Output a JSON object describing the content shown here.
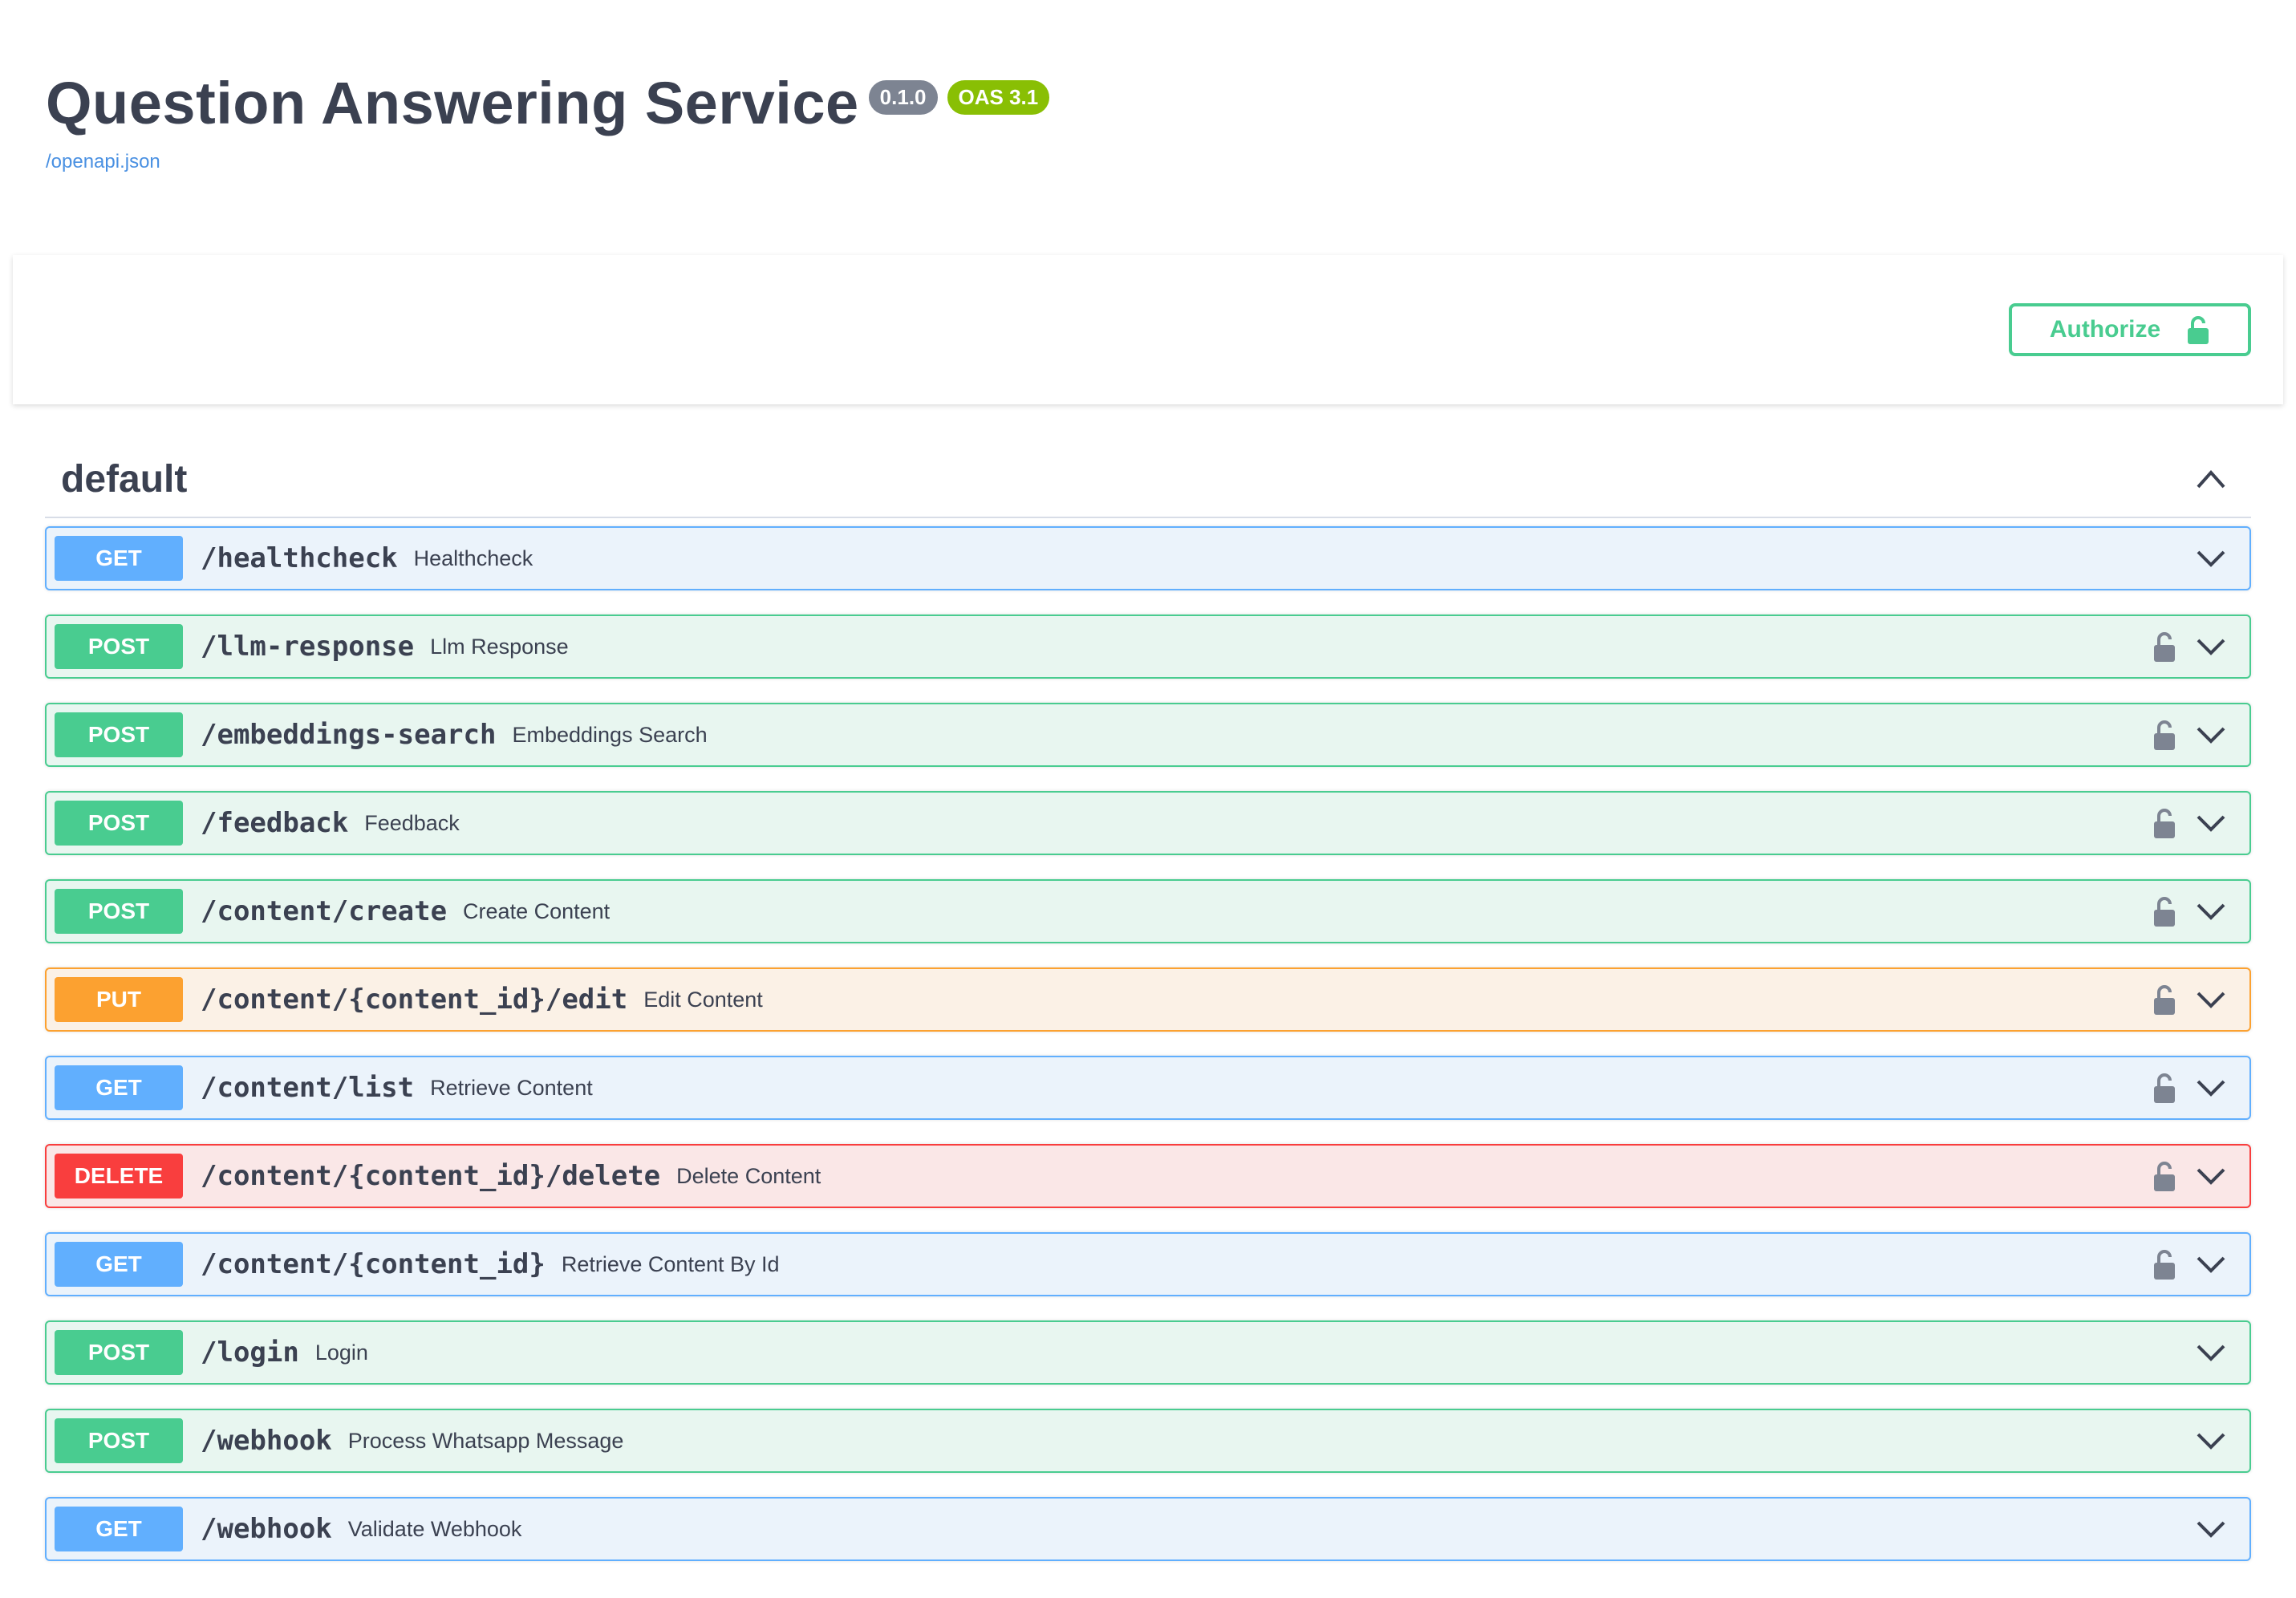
{
  "info": {
    "title": "Question Answering Service",
    "version": "0.1.0",
    "oas": "OAS 3.1",
    "spec_link": "/openapi.json"
  },
  "authorize": {
    "label": "Authorize"
  },
  "tag": {
    "name": "default"
  },
  "operations": [
    {
      "method": "GET",
      "path": "/healthcheck",
      "summary": "Healthcheck",
      "locked": false
    },
    {
      "method": "POST",
      "path": "/llm-response",
      "summary": "Llm Response",
      "locked": true
    },
    {
      "method": "POST",
      "path": "/embeddings-search",
      "summary": "Embeddings Search",
      "locked": true
    },
    {
      "method": "POST",
      "path": "/feedback",
      "summary": "Feedback",
      "locked": true
    },
    {
      "method": "POST",
      "path": "/content/create",
      "summary": "Create Content",
      "locked": true
    },
    {
      "method": "PUT",
      "path": "/content/{content_id}/edit",
      "summary": "Edit Content",
      "locked": true
    },
    {
      "method": "GET",
      "path": "/content/list",
      "summary": "Retrieve Content",
      "locked": true
    },
    {
      "method": "DELETE",
      "path": "/content/{content_id}/delete",
      "summary": "Delete Content",
      "locked": true
    },
    {
      "method": "GET",
      "path": "/content/{content_id}",
      "summary": "Retrieve Content By Id",
      "locked": true
    },
    {
      "method": "POST",
      "path": "/login",
      "summary": "Login",
      "locked": false
    },
    {
      "method": "POST",
      "path": "/webhook",
      "summary": "Process Whatsapp Message",
      "locked": false
    },
    {
      "method": "GET",
      "path": "/webhook",
      "summary": "Validate Webhook",
      "locked": false
    }
  ],
  "colors": {
    "get": "#61affe",
    "post": "#49cc90",
    "put": "#fca130",
    "delete": "#f93e3e",
    "version_badge": "#7d8492",
    "oas_badge": "#89bf04",
    "link": "#4990e2"
  },
  "icons": {
    "authorize": "unlocked-padlock-icon",
    "operation_lock": "unlocked-padlock-icon",
    "expand": "chevron-down-icon",
    "collapse": "chevron-up-icon"
  }
}
